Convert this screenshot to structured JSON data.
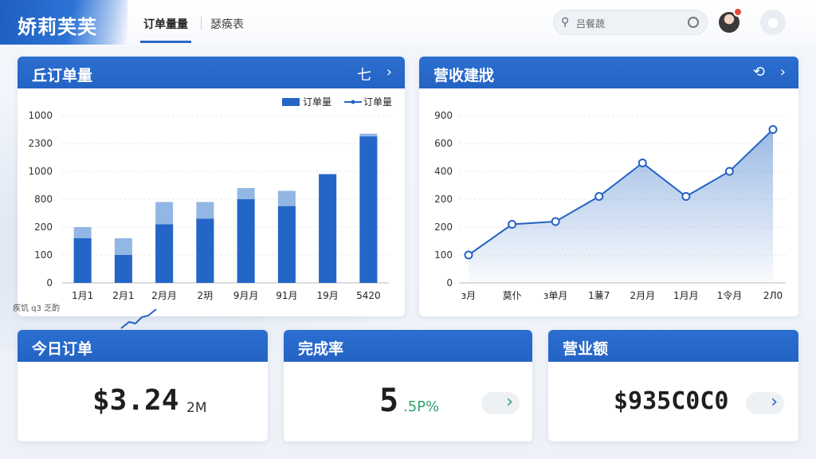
{
  "header": {
    "brand": "娇莉芙芙",
    "tabs": [
      {
        "label": "订单量量"
      },
      {
        "label": "瑟痪表"
      }
    ],
    "search": {
      "placeholder": "吕餐蔬",
      "icon": "search-icon"
    }
  },
  "orders_card": {
    "title": "丘订单量",
    "action_symbol": "七",
    "chevron": "›",
    "legend": {
      "bar": "订单量",
      "line": "订单量"
    }
  },
  "revenue_card": {
    "title": "营收建戕",
    "action_symbol": "⟲",
    "chevron": "›"
  },
  "floating_note": "疾饥 q3 乏酌",
  "stats": [
    {
      "title": "今日订单",
      "value": "$3.24",
      "suffix": "2M"
    },
    {
      "title": "完成率",
      "value": "5",
      "suffix": ".5P%",
      "button": "›"
    },
    {
      "title": "营业额",
      "value": "$935C0C0",
      "button": "›"
    }
  ],
  "colors": {
    "primary": "#2463c4",
    "bar_light": "#93b7e4",
    "green": "#2ea36b"
  },
  "chart_data": [
    {
      "type": "bar",
      "title": "丘订单量",
      "categories": [
        "1月1",
        "2月1",
        "2月月",
        "2玥",
        "9月月",
        "91月",
        "19月",
        "5420"
      ],
      "y_tick_labels": [
        "0",
        "100",
        "200",
        "800",
        "1000",
        "2300",
        "1000"
      ],
      "legend": [
        "订单量",
        "订单量"
      ],
      "series": [
        {
          "name": "订单量",
          "values": [
            1.6,
            1.0,
            2.1,
            2.3,
            3.0,
            2.75,
            3.9,
            5.25
          ]
        },
        {
          "name": "订单量",
          "values": [
            2.0,
            1.6,
            2.9,
            2.9,
            3.4,
            3.3,
            3.9,
            5.35
          ]
        }
      ],
      "ylim": [
        0,
        6
      ]
    },
    {
      "type": "area",
      "title": "营收建戕",
      "categories": [
        "з月",
        "莫仆",
        "з单月",
        "1蒹7",
        "2月月",
        "1月月",
        "1令月",
        "2Л0"
      ],
      "y_tick_labels": [
        "0",
        "100",
        "200",
        "200",
        "400",
        "600",
        "900"
      ],
      "values": [
        1.0,
        2.1,
        2.2,
        3.1,
        4.3,
        3.1,
        4.0,
        5.5
      ],
      "ylim": [
        0,
        6
      ]
    }
  ]
}
